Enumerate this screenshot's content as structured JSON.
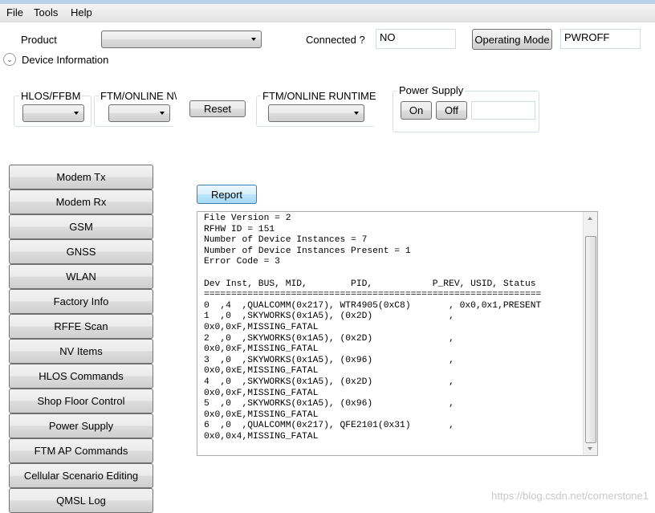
{
  "menu": [
    "File",
    "Tools",
    "Help"
  ],
  "header": {
    "product_label": "Product",
    "product_value": "",
    "connected_label": "Connected ?",
    "connected_value": "NO",
    "operating_mode_button": "Operating Mode",
    "operating_mode_value": "PWROFF",
    "device_info_label": "Device Information"
  },
  "controls": {
    "hlos_label": "HLOS/FFBM",
    "ftm_online_nv_label": "FTM/ONLINE N\\",
    "reset_button": "Reset",
    "ftm_runtime_label": "FTM/ONLINE RUNTIME",
    "power_supply_label": "Power Supply",
    "on_button": "On",
    "off_button": "Off",
    "power_value": ""
  },
  "sidebar": {
    "items": [
      "Modem Tx",
      "Modem Rx",
      "GSM",
      "GNSS",
      "WLAN",
      "Factory Info",
      "RFFE Scan",
      "NV Items",
      "HLOS Commands",
      "Shop Floor Control",
      "Power Supply",
      "FTM AP Commands",
      "Cellular Scenario Editing",
      "QMSL Log"
    ]
  },
  "report": {
    "button": "Report",
    "output": "File Version = 2\nRFHW ID = 151\nNumber of Device Instances = 7\nNumber of Device Instances Present = 1\nError Code = 3\n\nDev Inst, BUS, MID,        PID,           P_REV, USID, Status\n==============================================================\n0  ,4  ,QUALCOMM(0x217), WTR4905(0xC8)       , 0x0,0x1,PRESENT\n1  ,0  ,SKYWORKS(0x1A5), (0x2D)              ,\n0x0,0xF,MISSING_FATAL\n2  ,0  ,SKYWORKS(0x1A5), (0x2D)              ,\n0x0,0xF,MISSING_FATAL\n3  ,0  ,SKYWORKS(0x1A5), (0x96)              ,\n0x0,0xE,MISSING_FATAL\n4  ,0  ,SKYWORKS(0x1A5), (0x2D)              ,\n0x0,0xF,MISSING_FATAL\n5  ,0  ,SKYWORKS(0x1A5), (0x96)              ,\n0x0,0xE,MISSING_FATAL\n6  ,0  ,QUALCOMM(0x217), QFE2101(0x31)       ,\n0x0,0x4,MISSING_FATAL"
  },
  "watermark": "https://blog.csdn.net/cornerstone1"
}
